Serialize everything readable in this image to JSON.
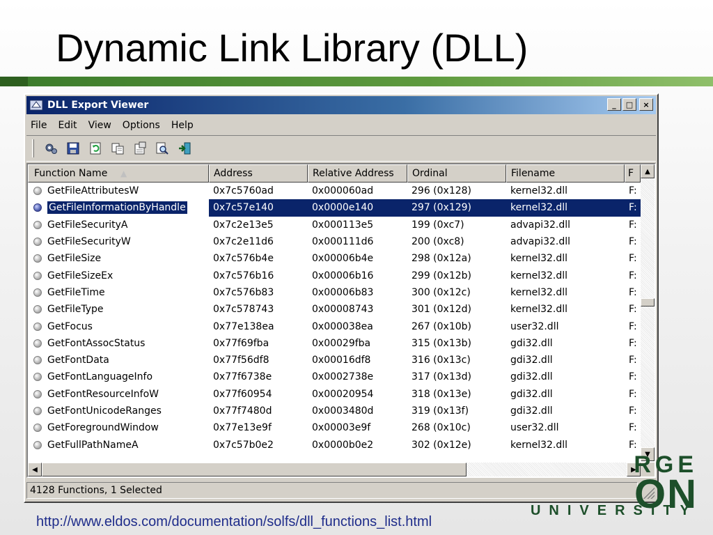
{
  "slide": {
    "title": "Dynamic Link Library (DLL)",
    "footer_link": "http://www.eldos.com/documentation/solfs/dll_functions_list.html",
    "logo": {
      "line1": "RGE",
      "line2": "ON",
      "line3": "UNIVERSITY"
    }
  },
  "window": {
    "title": "DLL Export Viewer",
    "buttons": {
      "minimize": "_",
      "maximize": "□",
      "close": "×"
    },
    "menu": [
      "File",
      "Edit",
      "View",
      "Options",
      "Help"
    ],
    "toolbar_icons": [
      "properties-gear-icon",
      "save-icon",
      "refresh-icon",
      "copy-icon",
      "html-report-icon",
      "find-icon",
      "exit-icon"
    ],
    "columns": [
      "Function Name",
      "Address",
      "Relative Address",
      "Ordinal",
      "Filename",
      "F"
    ],
    "rows": [
      {
        "name": "GetFileAttributesW",
        "address": "0x7c5760ad",
        "relative": "0x000060ad",
        "ordinal": "296 (0x128)",
        "filename": "kernel32.dll",
        "f": "F:"
      },
      {
        "name": "GetFileInformationByHandle",
        "address": "0x7c57e140",
        "relative": "0x0000e140",
        "ordinal": "297 (0x129)",
        "filename": "kernel32.dll",
        "f": "F:",
        "selected": true
      },
      {
        "name": "GetFileSecurityA",
        "address": "0x7c2e13e5",
        "relative": "0x000113e5",
        "ordinal": "199 (0xc7)",
        "filename": "advapi32.dll",
        "f": "F:"
      },
      {
        "name": "GetFileSecurityW",
        "address": "0x7c2e11d6",
        "relative": "0x000111d6",
        "ordinal": "200 (0xc8)",
        "filename": "advapi32.dll",
        "f": "F:"
      },
      {
        "name": "GetFileSize",
        "address": "0x7c576b4e",
        "relative": "0x00006b4e",
        "ordinal": "298 (0x12a)",
        "filename": "kernel32.dll",
        "f": "F:"
      },
      {
        "name": "GetFileSizeEx",
        "address": "0x7c576b16",
        "relative": "0x00006b16",
        "ordinal": "299 (0x12b)",
        "filename": "kernel32.dll",
        "f": "F:"
      },
      {
        "name": "GetFileTime",
        "address": "0x7c576b83",
        "relative": "0x00006b83",
        "ordinal": "300 (0x12c)",
        "filename": "kernel32.dll",
        "f": "F:"
      },
      {
        "name": "GetFileType",
        "address": "0x7c578743",
        "relative": "0x00008743",
        "ordinal": "301 (0x12d)",
        "filename": "kernel32.dll",
        "f": "F:"
      },
      {
        "name": "GetFocus",
        "address": "0x77e138ea",
        "relative": "0x000038ea",
        "ordinal": "267 (0x10b)",
        "filename": "user32.dll",
        "f": "F:"
      },
      {
        "name": "GetFontAssocStatus",
        "address": "0x77f69fba",
        "relative": "0x00029fba",
        "ordinal": "315 (0x13b)",
        "filename": "gdi32.dll",
        "f": "F:"
      },
      {
        "name": "GetFontData",
        "address": "0x77f56df8",
        "relative": "0x00016df8",
        "ordinal": "316 (0x13c)",
        "filename": "gdi32.dll",
        "f": "F:"
      },
      {
        "name": "GetFontLanguageInfo",
        "address": "0x77f6738e",
        "relative": "0x0002738e",
        "ordinal": "317 (0x13d)",
        "filename": "gdi32.dll",
        "f": "F:"
      },
      {
        "name": "GetFontResourceInfoW",
        "address": "0x77f60954",
        "relative": "0x00020954",
        "ordinal": "318 (0x13e)",
        "filename": "gdi32.dll",
        "f": "F:"
      },
      {
        "name": "GetFontUnicodeRanges",
        "address": "0x77f7480d",
        "relative": "0x0003480d",
        "ordinal": "319 (0x13f)",
        "filename": "gdi32.dll",
        "f": "F:"
      },
      {
        "name": "GetForegroundWindow",
        "address": "0x77e13e9f",
        "relative": "0x00003e9f",
        "ordinal": "268 (0x10c)",
        "filename": "user32.dll",
        "f": "F:"
      },
      {
        "name": "GetFullPathNameA",
        "address": "0x7c57b0e2",
        "relative": "0x0000b0e2",
        "ordinal": "302 (0x12e)",
        "filename": "kernel32.dll",
        "f": "F:"
      }
    ],
    "status": "4128 Functions, 1 Selected"
  }
}
